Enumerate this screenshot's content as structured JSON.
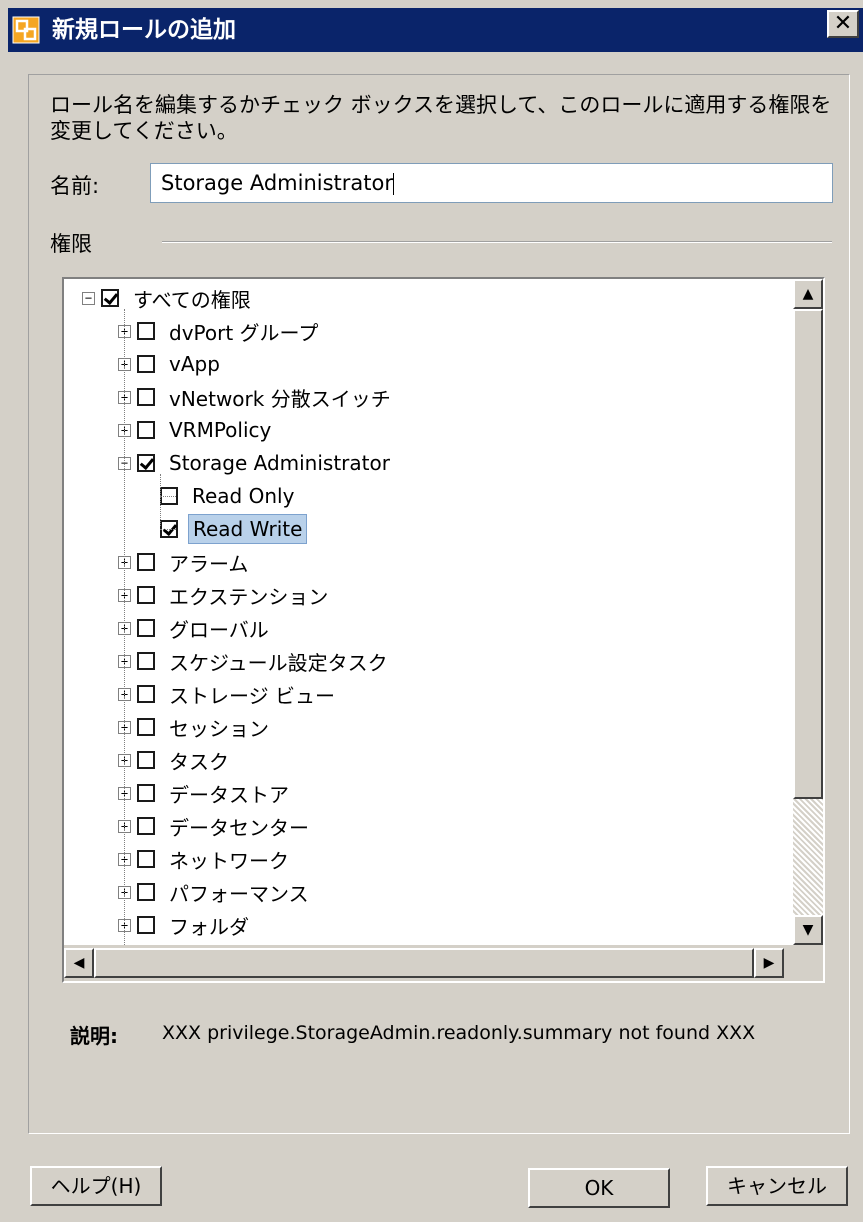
{
  "window": {
    "title": "新規ロールの追加",
    "close_glyph": "✕",
    "app_icon": "vsphere-role-icon"
  },
  "form": {
    "instructions": "ロール名を編集するかチェック ボックスを選択して、このロールに適用する権限を変更してください。",
    "name_label": "名前:",
    "name_value": "Storage Administrator",
    "privileges_label": "権限"
  },
  "tree": {
    "expand_glyph": "+",
    "collapse_glyph": "−",
    "root": {
      "label": "すべての権限",
      "checked": true,
      "expanded": true
    },
    "items": [
      {
        "label": "dvPort グループ",
        "checked": false,
        "expanded": false,
        "level": 1
      },
      {
        "label": "vApp",
        "checked": false,
        "expanded": false,
        "level": 1
      },
      {
        "label": "vNetwork 分散スイッチ",
        "checked": false,
        "expanded": false,
        "level": 1
      },
      {
        "label": "VRMPolicy",
        "checked": false,
        "expanded": false,
        "level": 1
      },
      {
        "label": "Storage Administrator",
        "checked": true,
        "expanded": true,
        "level": 1
      },
      {
        "label": "Read Only",
        "checked": false,
        "level": 2
      },
      {
        "label": "Read Write",
        "checked": true,
        "level": 2,
        "selected": true
      },
      {
        "label": "アラーム",
        "checked": false,
        "expanded": false,
        "level": 1
      },
      {
        "label": "エクステンション",
        "checked": false,
        "expanded": false,
        "level": 1
      },
      {
        "label": "グローバル",
        "checked": false,
        "expanded": false,
        "level": 1
      },
      {
        "label": "スケジュール設定タスク",
        "checked": false,
        "expanded": false,
        "level": 1
      },
      {
        "label": "ストレージ ビュー",
        "checked": false,
        "expanded": false,
        "level": 1
      },
      {
        "label": "セッション",
        "checked": false,
        "expanded": false,
        "level": 1
      },
      {
        "label": "タスク",
        "checked": false,
        "expanded": false,
        "level": 1
      },
      {
        "label": "データストア",
        "checked": false,
        "expanded": false,
        "level": 1
      },
      {
        "label": "データセンター",
        "checked": false,
        "expanded": false,
        "level": 1
      },
      {
        "label": "ネットワーク",
        "checked": false,
        "expanded": false,
        "level": 1
      },
      {
        "label": "パフォーマンス",
        "checked": false,
        "expanded": false,
        "level": 1
      },
      {
        "label": "フォルダ",
        "checked": false,
        "expanded": false,
        "level": 1
      }
    ]
  },
  "scroll": {
    "up_glyph": "▲",
    "down_glyph": "▼",
    "left_glyph": "◀",
    "right_glyph": "▶"
  },
  "description": {
    "label": "説明:",
    "text": "XXX privilege.StorageAdmin.readonly.summary not found XXX"
  },
  "buttons": {
    "help": "ヘルプ(H)",
    "ok": "OK",
    "cancel": "キャンセル"
  }
}
